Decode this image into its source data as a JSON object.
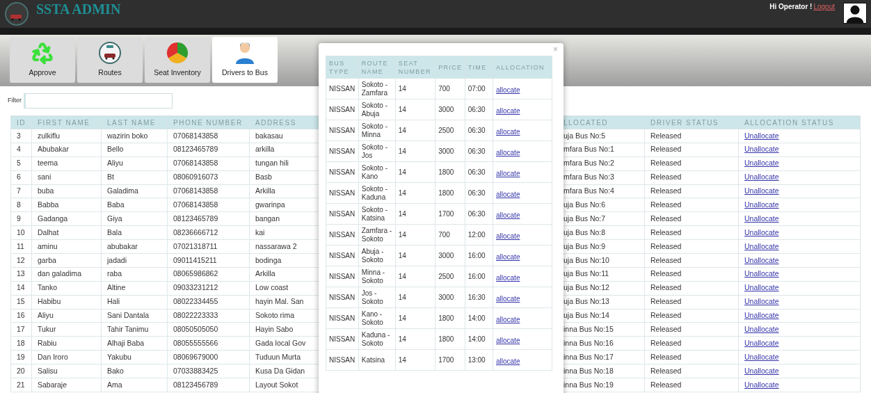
{
  "header": {
    "title": "SSTA ADMIN",
    "greeting": "Hi Operator !",
    "logout": "Logout"
  },
  "tabs": [
    {
      "label": "Approve",
      "kind": "recycle",
      "selected": false
    },
    {
      "label": "Routes",
      "kind": "routes",
      "selected": false
    },
    {
      "label": "Seat Inventory",
      "kind": "pie",
      "selected": false
    },
    {
      "label": "Drivers to Bus",
      "kind": "driver",
      "selected": true
    }
  ],
  "filter": {
    "label": "Filter"
  },
  "drivers_table": {
    "columns": [
      "ID",
      "FIRST NAME",
      "LAST NAME",
      "PHONE NUMBER",
      "ADDRESS",
      "LLOCATED",
      "DRIVER STATUS",
      "ALLOCATION STATUS"
    ],
    "rows": [
      [
        "3",
        "zulkiflu",
        "wazirin boko",
        "07068143858",
        "bakasau",
        "uja Bus No:5",
        "Released",
        "Unallocate"
      ],
      [
        "4",
        "Abubakar",
        "Bello",
        "08123465789",
        "arkilla",
        "mfara Bus No:1",
        "Released",
        "Unallocate"
      ],
      [
        "5",
        "teema",
        "Aliyu",
        "07068143858",
        "tungan hili",
        "mfara Bus No:2",
        "Released",
        "Unallocate"
      ],
      [
        "6",
        "sani",
        "Bt",
        "08060916073",
        "Basb",
        "mfara Bus No:3",
        "Released",
        "Unallocate"
      ],
      [
        "7",
        "buba",
        "Galadima",
        "07068143858",
        "Arkilla",
        "mfara Bus No:4",
        "Released",
        "Unallocate"
      ],
      [
        "8",
        "Babba",
        "Baba",
        "07068143858",
        "gwarinpa",
        "uja Bus No:6",
        "Released",
        "Unallocate"
      ],
      [
        "9",
        "Gadanga",
        "Giya",
        "08123465789",
        "bangan",
        "uja Bus No:7",
        "Released",
        "Unallocate"
      ],
      [
        "10",
        "Dalhat",
        "Bala",
        "08236666712",
        "kai",
        "uja Bus No:8",
        "Released",
        "Unallocate"
      ],
      [
        "11",
        "aminu",
        "abubakar",
        "07021318711",
        "nassarawa 2",
        "uja Bus No:9",
        "Released",
        "Unallocate"
      ],
      [
        "12",
        "garba",
        "jadadi",
        "09011415211",
        "bodinga",
        "uja Bus No:10",
        "Released",
        "Unallocate"
      ],
      [
        "13",
        "dan galadima",
        "raba",
        "08065986862",
        "Arkilla",
        "uja Bus No:11",
        "Released",
        "Unallocate"
      ],
      [
        "14",
        "Tanko",
        "Altine",
        "09033231212",
        "Low coast",
        "uja Bus No:12",
        "Released",
        "Unallocate"
      ],
      [
        "15",
        "Habibu",
        "Hali",
        "08022334455",
        "hayin Mal. San",
        "uja Bus No:13",
        "Released",
        "Unallocate"
      ],
      [
        "16",
        "Aliyu",
        "Sani Dantala",
        "08022223333",
        "Sokoto rima",
        "uja Bus No:14",
        "Released",
        "Unallocate"
      ],
      [
        "17",
        "Tukur",
        "Tahir Tanimu",
        "08050505050",
        "Hayin Sabo",
        "inna Bus No:15",
        "Released",
        "Unallocate"
      ],
      [
        "18",
        "Rabiu",
        "Alhaji Baba",
        "08055555566",
        "Gada local Gov",
        "inna Bus No:16",
        "Released",
        "Unallocate"
      ],
      [
        "19",
        "Dan Iroro",
        "Yakubu",
        "08069679000",
        "Tuduun Murta",
        "inna Bus No:17",
        "Released",
        "Unallocate"
      ],
      [
        "20",
        "Salisu",
        "Bako",
        "07033883425",
        "Kusa Da Gidan",
        "inna Bus No:18",
        "Released",
        "Unallocate"
      ],
      [
        "21",
        "Sabaraje",
        "Ama",
        "08123456789",
        "Layout Sokot",
        "inna Bus No:19",
        "Released",
        "Unallocate"
      ]
    ]
  },
  "modal": {
    "close": "×",
    "columns": [
      "BUS TYPE",
      "ROUTE NAME",
      "SEAT NUMBER",
      "PRICE",
      "TIME",
      "ALLOCATION"
    ],
    "rows": [
      [
        "NISSAN",
        "Sokoto - Zamfara",
        "14",
        "700",
        "07:00",
        "allocate"
      ],
      [
        "NISSAN",
        "Sokoto - Abuja",
        "14",
        "3000",
        "06:30",
        "allocate"
      ],
      [
        "NISSAN",
        "Sokoto - Minna",
        "14",
        "2500",
        "06:30",
        "allocate"
      ],
      [
        "NISSAN",
        "Sokoto - Jos",
        "14",
        "3000",
        "06:30",
        "allocate"
      ],
      [
        "NISSAN",
        "Sokoto - Kano",
        "14",
        "1800",
        "06:30",
        "allocate"
      ],
      [
        "NISSAN",
        "Sokoto - Kaduna",
        "14",
        "1800",
        "06:30",
        "allocate"
      ],
      [
        "NISSAN",
        "Sokoto - Katsina",
        "14",
        "1700",
        "06:30",
        "allocate"
      ],
      [
        "NISSAN",
        "Zamfara - Sokoto",
        "14",
        "700",
        "12:00",
        "allocate"
      ],
      [
        "NISSAN",
        "Abuja - Sokoto",
        "14",
        "3000",
        "16:00",
        "allocate"
      ],
      [
        "NISSAN",
        "Minna - Sokoto",
        "14",
        "2500",
        "16:00",
        "allocate"
      ],
      [
        "NISSAN",
        "Jos - Sokoto",
        "14",
        "3000",
        "16:30",
        "allocate"
      ],
      [
        "NISSAN",
        "Kano - Sokoto",
        "14",
        "1800",
        "14:00",
        "allocate"
      ],
      [
        "NISSAN",
        "Kaduna - Sokoto",
        "14",
        "1800",
        "14:00",
        "allocate"
      ],
      [
        "NISSAN",
        "Katsina",
        "14",
        "1700",
        "13:00",
        "allocate"
      ]
    ]
  }
}
